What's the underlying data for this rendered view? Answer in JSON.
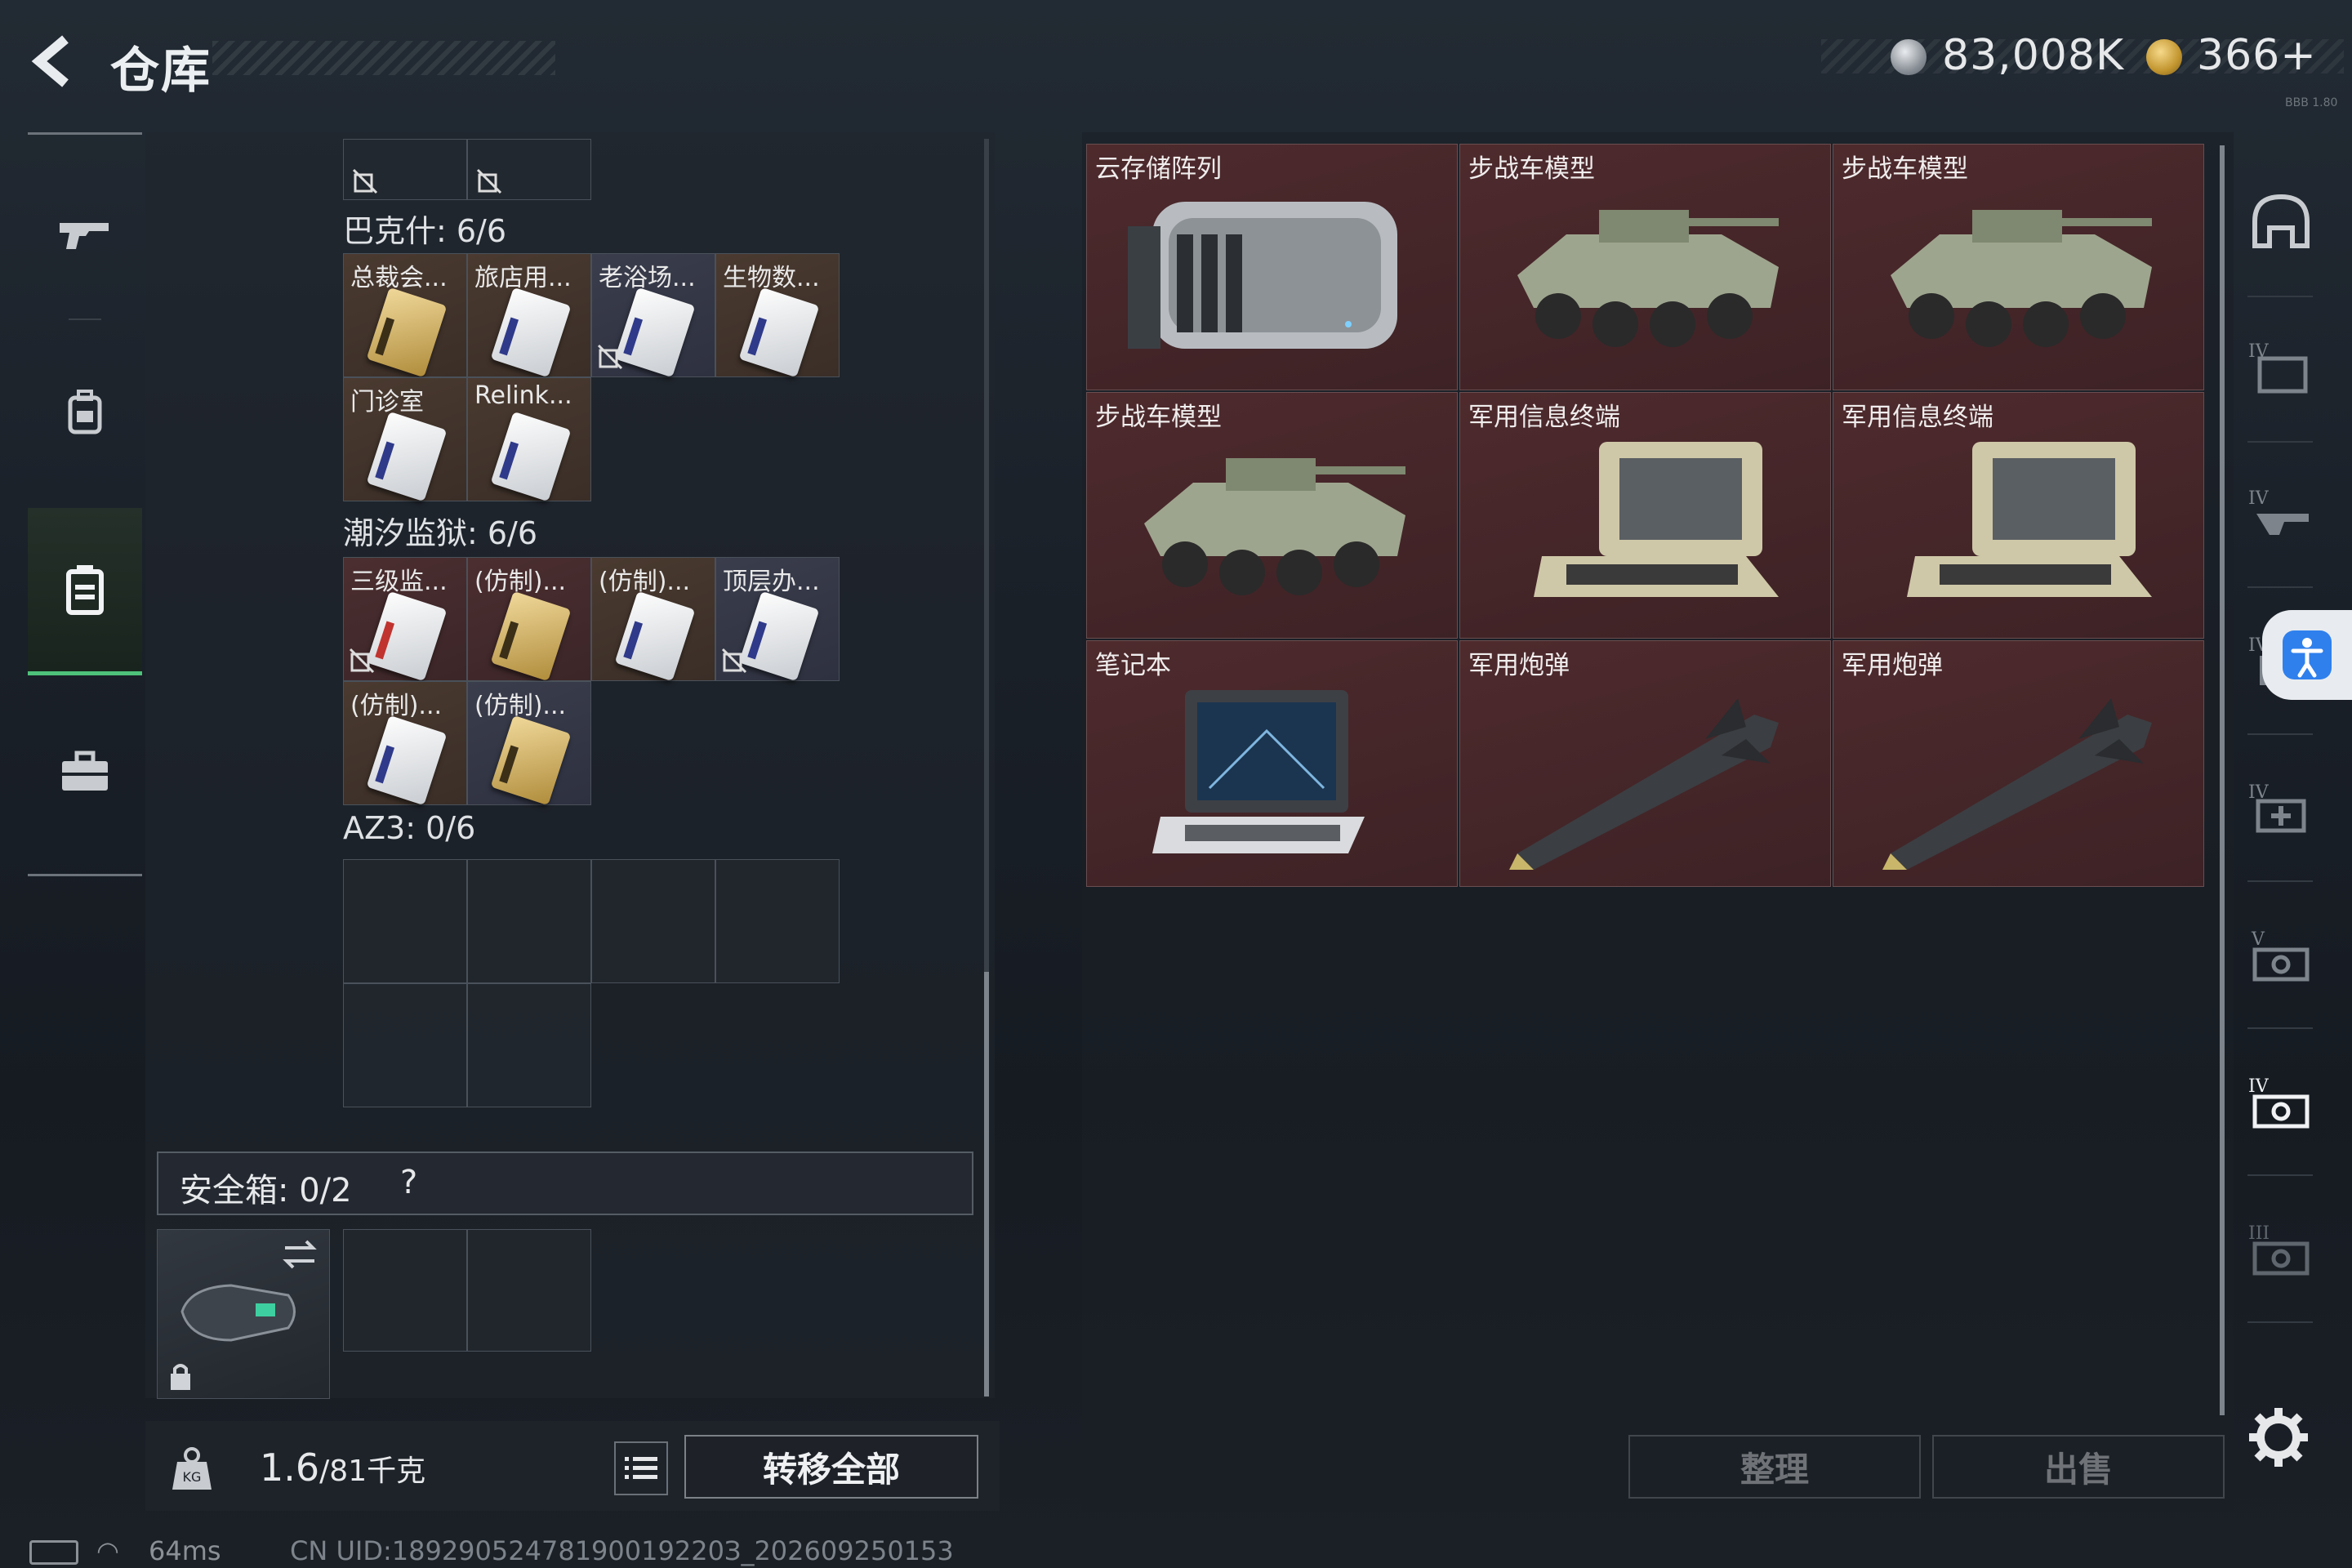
{
  "header": {
    "title": "仓库"
  },
  "currency": {
    "silver": "83,008K",
    "gold": "366+",
    "version": "BBB 1.80"
  },
  "left_rail": [
    "weapon-icon",
    "backpack-icon",
    "container-icon",
    "toolbox-icon"
  ],
  "sections": [
    {
      "label": "巴克什: 6/6",
      "items": [
        "总裁会...",
        "旅店用...",
        "老浴场...",
        "生物数...",
        "门诊室",
        "Relink..."
      ]
    },
    {
      "label": "潮汐监狱: 6/6",
      "items": [
        "三级监...",
        "(仿制)...",
        "(仿制)...",
        "顶层办...",
        "(仿制)...",
        "(仿制)..."
      ]
    },
    {
      "label": "AZ3: 0/6",
      "items": []
    }
  ],
  "safebox": {
    "label": "安全箱: 0/2",
    "help": "?"
  },
  "footer": {
    "weight": "1.6",
    "capacity": "/81",
    "unit": "千克",
    "transfer_label": "转移全部",
    "sort_label": "整理",
    "sell_label": "出售"
  },
  "status": {
    "latency": "64ms",
    "uid": "CN UID:18929052478190019220З_202609250153"
  },
  "stash": [
    {
      "label": "云存储阵列",
      "icon": "storage-array-icon"
    },
    {
      "label": "步战车模型",
      "icon": "ifv-model-icon"
    },
    {
      "label": "步战车模型",
      "icon": "ifv-model-icon"
    },
    {
      "label": "步战车模型",
      "icon": "ifv-model-icon"
    },
    {
      "label": "军用信息终端",
      "icon": "military-terminal-icon"
    },
    {
      "label": "军用信息终端",
      "icon": "military-terminal-icon"
    },
    {
      "label": "笔记本",
      "icon": "laptop-icon"
    },
    {
      "label": "军用炮弹",
      "icon": "artillery-shell-icon"
    },
    {
      "label": "军用炮弹",
      "icon": "artillery-shell-icon"
    }
  ],
  "colors": {
    "accent_green": "#4ec27a",
    "stash_cell": "#4e2a2d",
    "access_blue": "#2f80ed"
  }
}
